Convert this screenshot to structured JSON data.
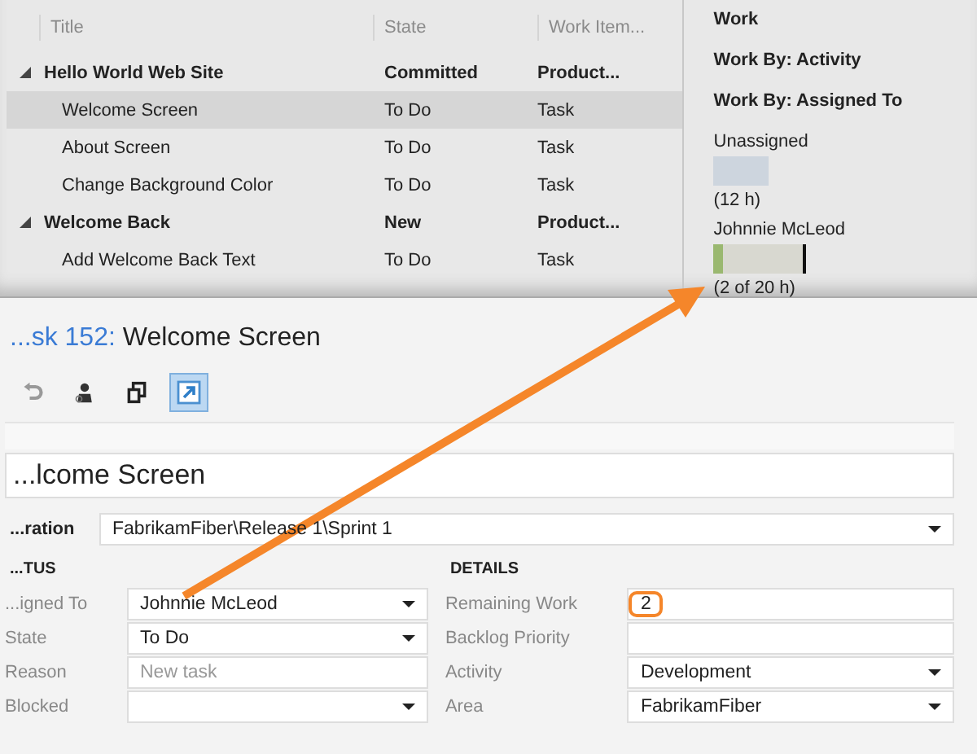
{
  "backlog": {
    "columns": [
      "Title",
      "State",
      "Work Item..."
    ],
    "rows": [
      {
        "title": "Hello World Web Site",
        "state": "Committed",
        "type": "Product...",
        "expanded": true,
        "selected": false,
        "children": [
          {
            "title": "Welcome Screen",
            "state": "To Do",
            "type": "Task",
            "selected": true
          },
          {
            "title": "About Screen",
            "state": "To Do",
            "type": "Task",
            "selected": false
          },
          {
            "title": "Change Background Color",
            "state": "To Do",
            "type": "Task",
            "selected": false
          }
        ]
      },
      {
        "title": "Welcome Back",
        "state": "New",
        "type": "Product...",
        "expanded": true,
        "selected": false,
        "children": [
          {
            "title": "Add Welcome Back Text",
            "state": "To Do",
            "type": "Task",
            "selected": false
          }
        ]
      }
    ]
  },
  "work_pane": {
    "headings": [
      "Work",
      "Work By: Activity",
      "Work By: Assigned To"
    ],
    "people": [
      {
        "name": "Unassigned",
        "kind": "unassigned",
        "reading": "(12 h)"
      },
      {
        "name": "Johnnie McLeod",
        "kind": "capacity",
        "level": 0.1,
        "reading": "(2 of 20 h)"
      }
    ]
  },
  "work_item": {
    "title_prefix": "...sk 152:",
    "title": "Welcome Screen",
    "toolbar": [
      {
        "kind": "undo",
        "disabled": true,
        "selected": false
      },
      {
        "kind": "assign",
        "disabled": false,
        "selected": false
      },
      {
        "kind": "copy",
        "disabled": false,
        "selected": false
      },
      {
        "kind": "open",
        "disabled": false,
        "selected": true
      }
    ],
    "title_field": "...lcome Screen",
    "iteration": {
      "label": "...ration",
      "value": "FabrikamFiber\\Release 1\\Sprint 1"
    },
    "sections": [
      {
        "heading": "...TUS",
        "fields": [
          {
            "label": "...igned To",
            "value": "Johnnie McLeod",
            "kind": "dropdown",
            "highlighted": false
          },
          {
            "label": "State",
            "value": "To Do",
            "kind": "dropdown",
            "highlighted": false
          },
          {
            "label": "Reason",
            "placeholder": "New task",
            "kind": "text",
            "highlighted": false
          },
          {
            "label": "Blocked",
            "kind": "dropdown",
            "highlighted": false
          }
        ]
      },
      {
        "heading": "DETAILS",
        "fields": [
          {
            "label": "Remaining Work",
            "value": "2",
            "kind": "text",
            "highlighted": true
          },
          {
            "label": "Backlog Priority",
            "kind": "text",
            "highlighted": false
          },
          {
            "label": "Activity",
            "value": "Development",
            "kind": "dropdown",
            "highlighted": false
          },
          {
            "label": "Area",
            "value": "FabrikamFiber",
            "kind": "dropdown",
            "highlighted": false
          }
        ]
      }
    ]
  }
}
